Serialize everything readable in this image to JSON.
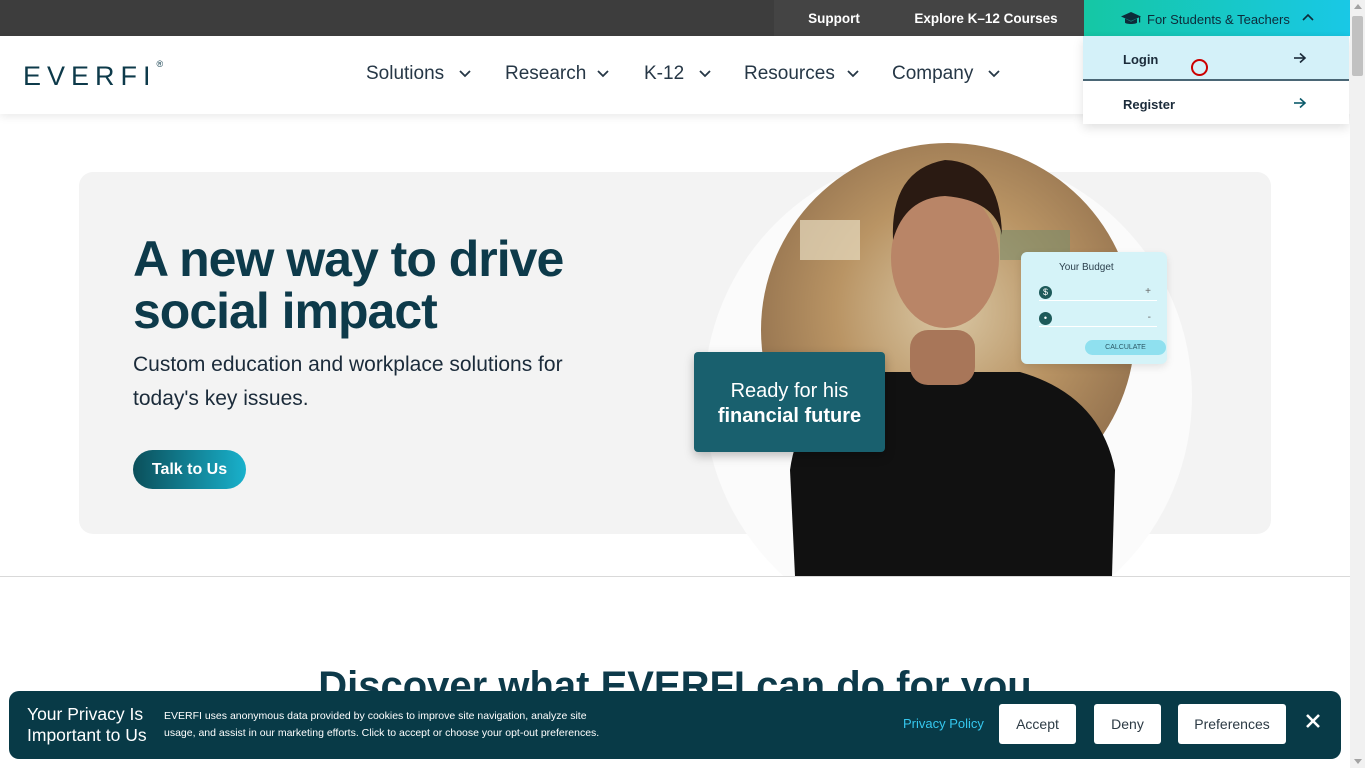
{
  "topbar": {
    "support": "Support",
    "explore": "Explore K–12 Courses",
    "students_teachers": "For Students & Teachers"
  },
  "logo": {
    "text": "EVERFI",
    "mark": "®"
  },
  "nav": {
    "items": [
      {
        "label": "Solutions"
      },
      {
        "label": "Research"
      },
      {
        "label": "K-12"
      },
      {
        "label": "Resources"
      },
      {
        "label": "Company"
      }
    ]
  },
  "dropdown": {
    "login": "Login",
    "register": "Register"
  },
  "hero": {
    "title": "A new way to drive social impact",
    "subtitle": "Custom education and workplace solutions for today's key issues.",
    "cta": "Talk to Us",
    "card_line1": "Ready for his",
    "card_line2": "financial future",
    "budget": {
      "title": "Your Budget",
      "row1_icon": "$",
      "row1_op": "+",
      "row2_icon": "•",
      "row2_op": "-",
      "button": "CALCULATE"
    }
  },
  "section": {
    "heading": "Discover what EVERFI can do for you"
  },
  "privacy": {
    "title": "Your Privacy Is Important to Us",
    "text": "EVERFI uses anonymous data provided by cookies to improve site navigation, analyze site usage, and assist in our marketing efforts. Click to accept or choose your opt-out preferences.",
    "policy_link": "Privacy Policy",
    "accept": "Accept",
    "deny": "Deny",
    "preferences": "Preferences"
  },
  "colors": {
    "brand_dark": "#0d3a4a",
    "accent_teal": "#19c8e6",
    "banner_bg": "#083a47"
  }
}
